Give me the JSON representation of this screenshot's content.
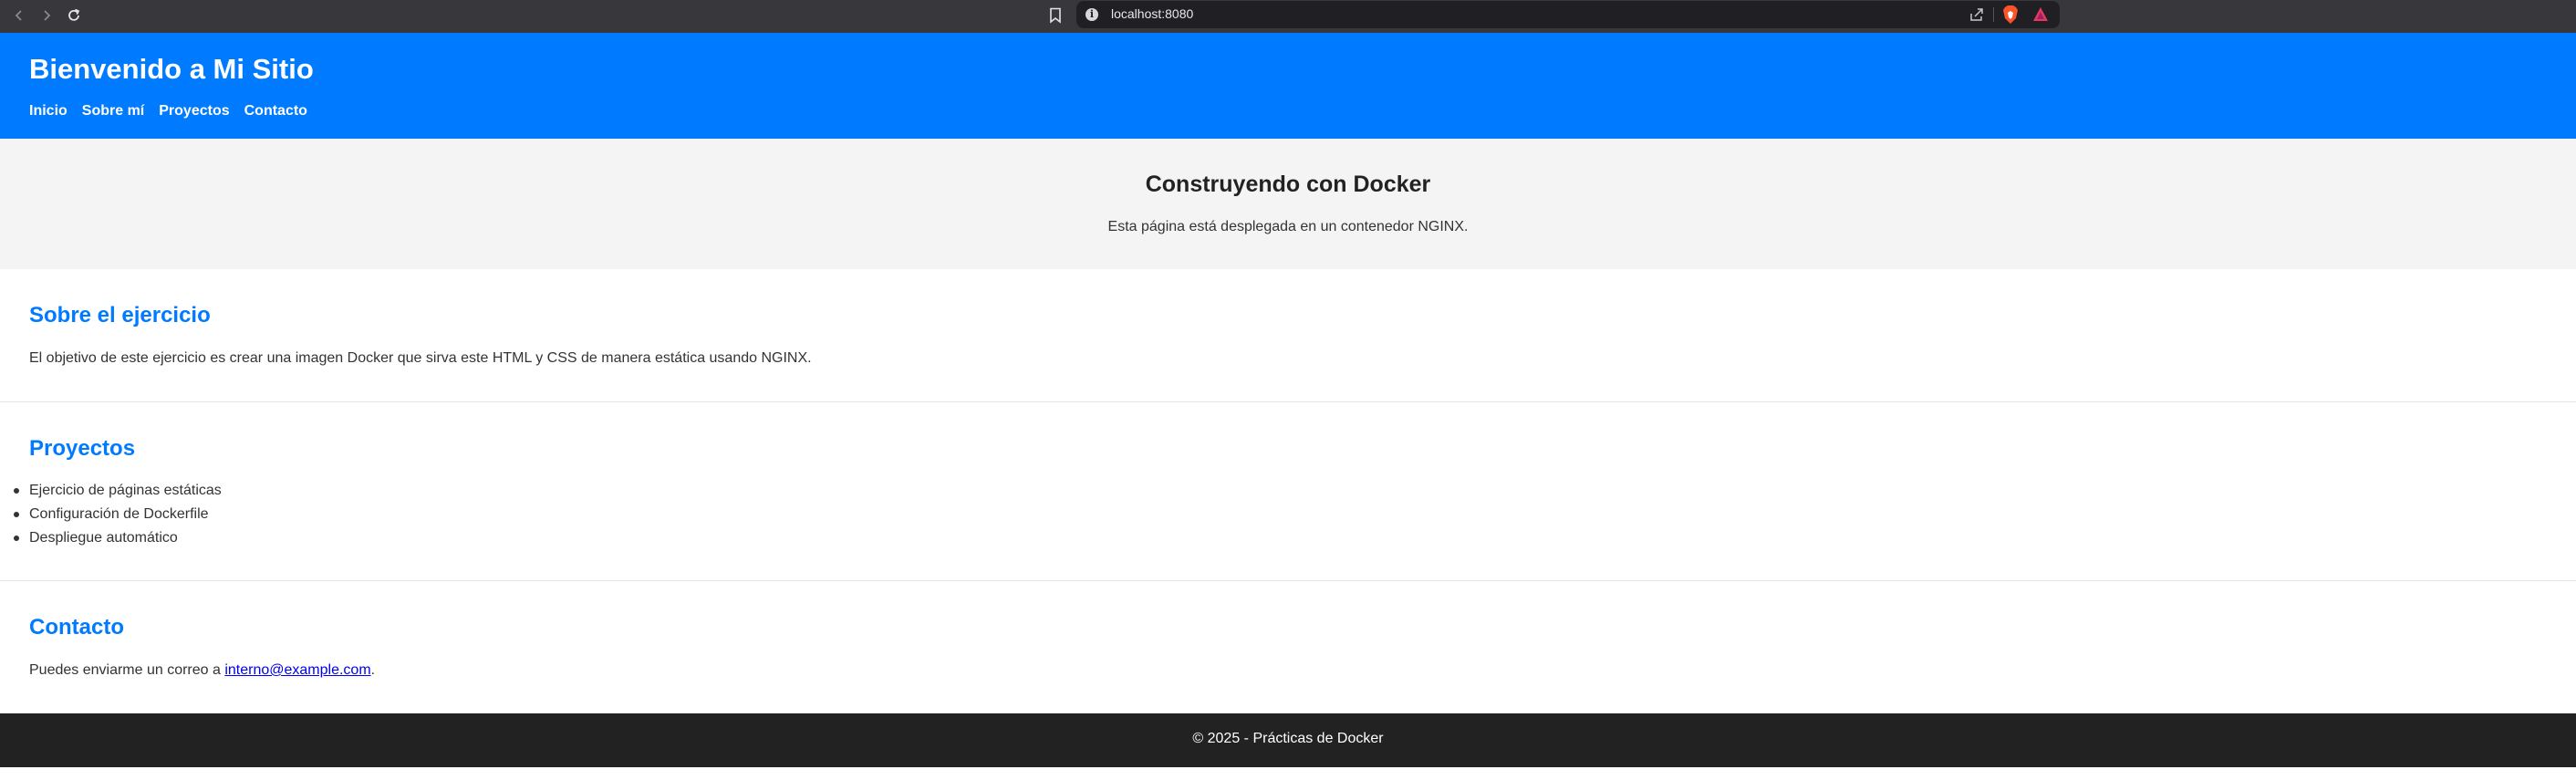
{
  "browser": {
    "url": "localhost:8080"
  },
  "header": {
    "title": "Bienvenido a Mi Sitio",
    "nav": [
      "Inicio",
      "Sobre mí",
      "Proyectos",
      "Contacto"
    ]
  },
  "hero": {
    "title": "Construyendo con Docker",
    "text": "Esta página está desplegada en un contenedor NGINX."
  },
  "about": {
    "title": "Sobre el ejercicio",
    "text": "El objetivo de este ejercicio es crear una imagen Docker que sirva este HTML y CSS de manera estática usando NGINX."
  },
  "projects": {
    "title": "Proyectos",
    "items": [
      "Ejercicio de páginas estáticas",
      "Configuración de Dockerfile",
      "Despliegue automático"
    ]
  },
  "contact": {
    "title": "Contacto",
    "text_before": "Puedes enviarme un correo a ",
    "email": "interno@example.com",
    "text_after": "."
  },
  "footer": {
    "text": "© 2025 - Prácticas de Docker"
  },
  "colors": {
    "accent": "#007bff",
    "hero_bg": "#f4f4f4",
    "footer_bg": "#222222",
    "chrome_bg": "#38373c"
  },
  "icons": [
    "back-icon",
    "forward-icon",
    "reload-icon",
    "bookmark-icon",
    "site-info-icon",
    "share-icon",
    "brave-shields-icon",
    "brave-rewards-icon"
  ]
}
